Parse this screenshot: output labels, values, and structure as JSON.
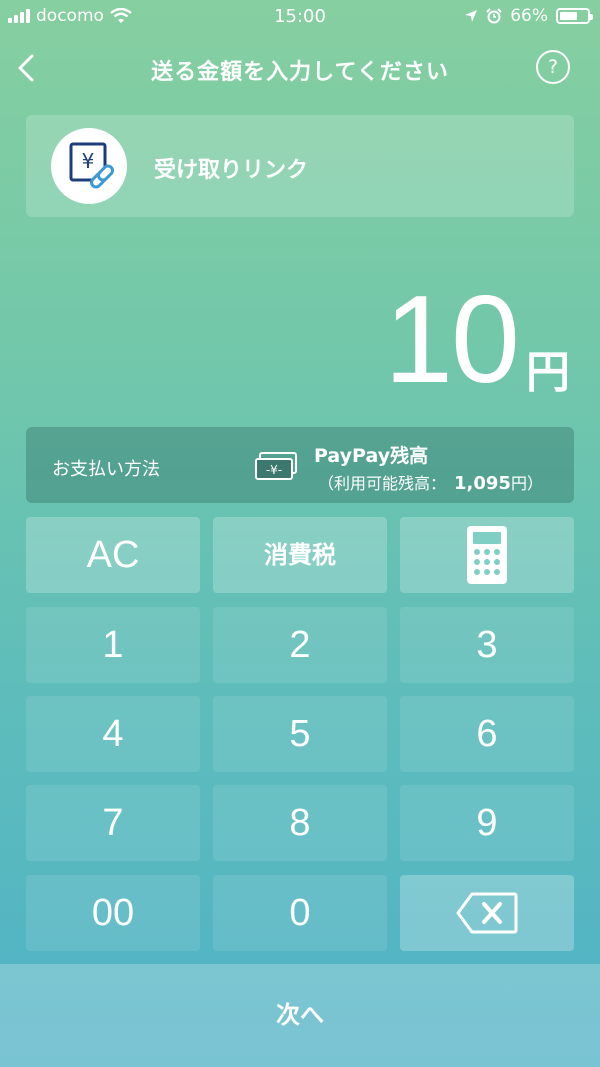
{
  "status_bar": {
    "carrier": "docomo",
    "time": "15:00",
    "battery": "66%",
    "battery_level": 0.66
  },
  "nav": {
    "title": "送る金額を入力してください",
    "help": "?"
  },
  "receive_link": {
    "label": "受け取りリンク",
    "icon": "yen-link-icon"
  },
  "amount": {
    "value": "10",
    "unit": "円"
  },
  "payment": {
    "label": "お支払い方法",
    "method": "PayPay残高",
    "balance_label": "（利用可能残高：",
    "balance_value": "1,095",
    "balance_unit": "円）"
  },
  "keypad": {
    "ac": "AC",
    "tax": "消費税",
    "calculator": "calculator-icon",
    "digits": [
      "1",
      "2",
      "3",
      "4",
      "5",
      "6",
      "7",
      "8",
      "9",
      "00",
      "0"
    ],
    "backspace": "backspace-icon"
  },
  "next_button": "次へ"
}
